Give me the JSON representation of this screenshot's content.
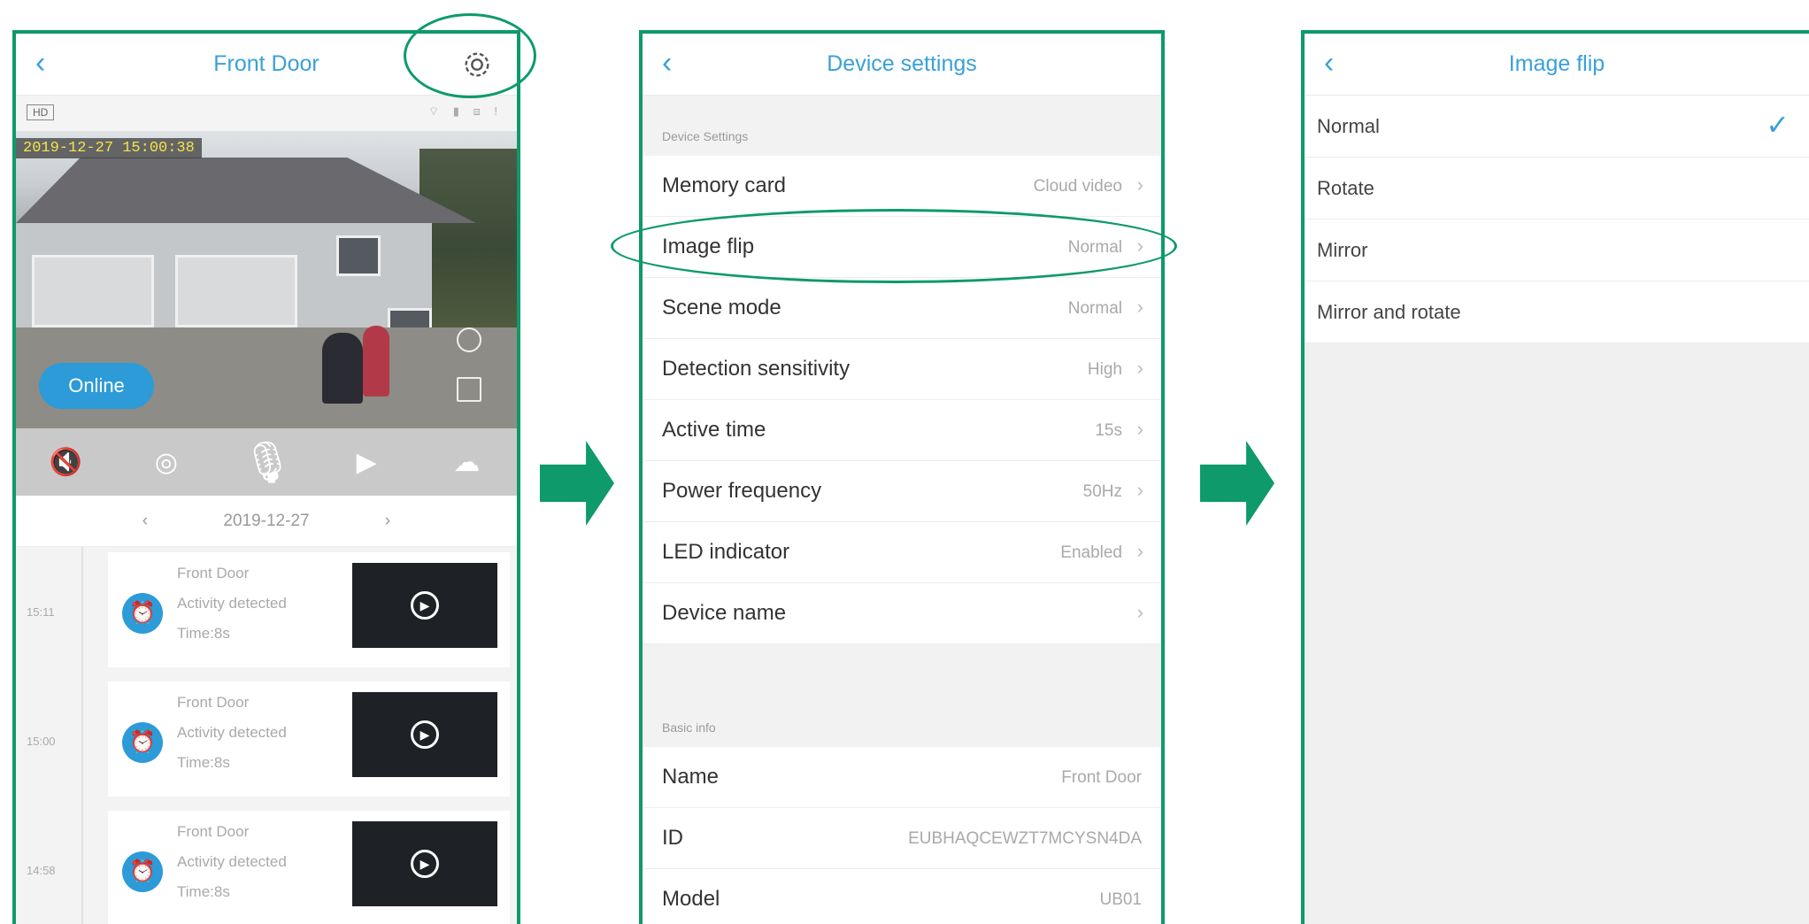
{
  "panel1": {
    "title": "Front Door",
    "back_icon": "‹",
    "hd_badge": "HD",
    "status_icons": "⌔ ▮ ⧈ !",
    "timestamp": "2019-12-27  15:00:38",
    "online_label": "Online",
    "controls": [
      {
        "icon": "speaker-mute-icon",
        "glyph": "🔇"
      },
      {
        "icon": "camera-icon",
        "glyph": "◎"
      },
      {
        "icon": "microphone-icon",
        "glyph": "🎙"
      },
      {
        "icon": "video-record-icon",
        "glyph": "▶"
      },
      {
        "icon": "cloud-icon",
        "glyph": "☁"
      }
    ],
    "date": {
      "prev": "‹",
      "value": "2019-12-27",
      "next": "›"
    },
    "events": [
      {
        "time": "15:11",
        "name": "Front Door",
        "activity": "Activity detected",
        "duration": "Time:8s"
      },
      {
        "time": "15:00",
        "name": "Front Door",
        "activity": "Activity detected",
        "duration": "Time:8s"
      },
      {
        "time": "14:58",
        "name": "Front Door",
        "activity": "Activity detected",
        "duration": "Time:8s"
      }
    ]
  },
  "panel2": {
    "title": "Device settings",
    "back_icon": "‹",
    "section1": "Device Settings",
    "rows": [
      {
        "label": "Memory card",
        "value": "Cloud video"
      },
      {
        "label": "Image flip",
        "value": "Normal"
      },
      {
        "label": "Scene mode",
        "value": "Normal"
      },
      {
        "label": "Detection sensitivity",
        "value": "High"
      },
      {
        "label": "Active time",
        "value": "15s"
      },
      {
        "label": "Power frequency",
        "value": "50Hz"
      },
      {
        "label": "LED indicator",
        "value": "Enabled"
      },
      {
        "label": "Device name",
        "value": ""
      }
    ],
    "section2": "Basic info",
    "info": [
      {
        "label": "Name",
        "value": "Front Door"
      },
      {
        "label": "ID",
        "value": "EUBHAQCEWZT7MCYSN4DA"
      },
      {
        "label": "Model",
        "value": "UB01"
      }
    ],
    "chevron": "›"
  },
  "panel3": {
    "title": "Image flip",
    "back_icon": "‹",
    "options": [
      "Normal",
      "Rotate",
      "Mirror",
      "Mirror and rotate"
    ],
    "selected": "Normal",
    "check": "✓"
  },
  "colors": {
    "accent": "#3aa0d8",
    "annotation": "#0e9a6b"
  }
}
